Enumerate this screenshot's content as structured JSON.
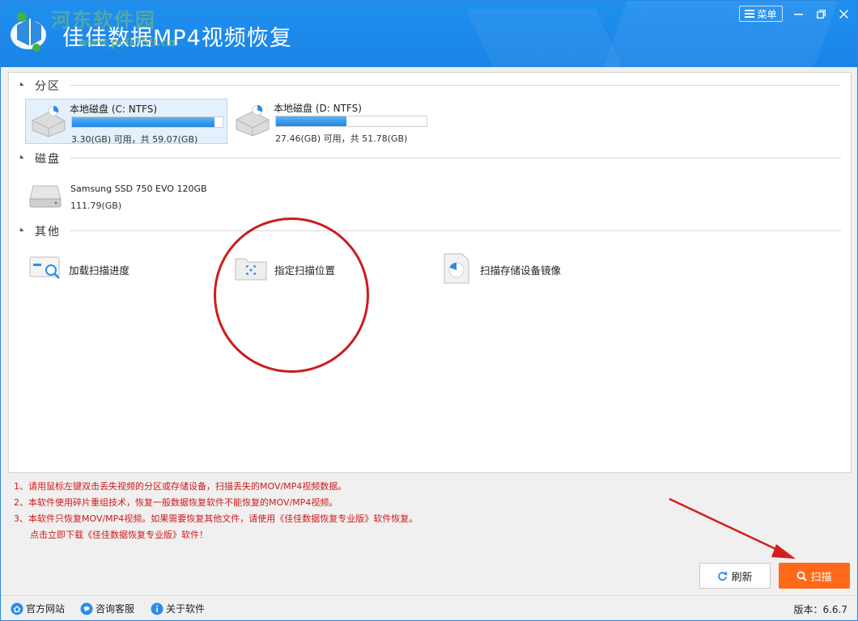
{
  "window": {
    "title": "佳佳数据MP4视频恢复",
    "watermark_site": "河东软件园",
    "watermark_url": "www.pc0359.cn",
    "menu_label": "菜单"
  },
  "partitions": {
    "heading": "分区",
    "items": [
      {
        "name": "本地磁盘 (C: NTFS)",
        "meta": "3.30(GB) 可用，共 59.07(GB)",
        "used_fraction": 0.944,
        "selected": true
      },
      {
        "name": "本地磁盘 (D: NTFS)",
        "meta": "27.46(GB) 可用，共 51.78(GB)",
        "used_fraction": 0.47,
        "selected": false
      }
    ]
  },
  "disks": {
    "heading": "磁盘",
    "items": [
      {
        "name": "Samsung SSD 750 EVO 120GB",
        "meta": "111.79(GB)"
      }
    ]
  },
  "others": {
    "heading": "其他",
    "items": [
      {
        "name": "加载扫描进度",
        "icon": "load-progress-icon"
      },
      {
        "name": "指定扫描位置",
        "icon": "folder-target-icon"
      },
      {
        "name": "扫描存储设备镜像",
        "icon": "disk-image-icon"
      }
    ]
  },
  "notes": [
    "1、请用鼠标左键双击丢失视频的分区或存储设备，扫描丢失的MOV/MP4视频数据。",
    "2、本软件使用碎片重组技术，恢复一般数据恢复软件不能恢复的MOV/MP4视频。",
    "3、本软件只恢复MOV/MP4视频。如果需要恢复其他文件，请使用《佳佳数据恢复专业版》软件恢复。",
    "点击立即下载《佳佳数据恢复专业版》软件！"
  ],
  "buttons": {
    "refresh": "刷新",
    "scan": "扫描"
  },
  "statusbar": {
    "website": "官方网站",
    "support": "咨询客服",
    "about": "关于软件",
    "version": "版本：6.6.7"
  },
  "colors": {
    "titlebar": "#1a84e6",
    "accent_orange": "#ff6a1a",
    "note_red": "#d01a1a",
    "progress_blue": "#1f86e3"
  }
}
